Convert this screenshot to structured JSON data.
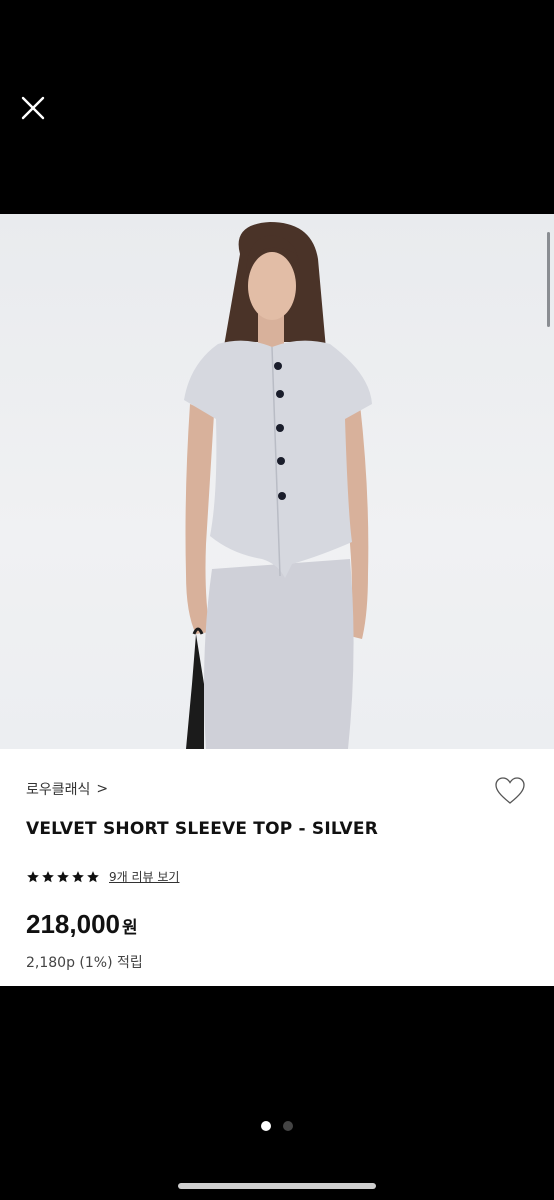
{
  "gallery": {
    "image_alt": "Model wearing velvet short sleeve top and skirt in silver",
    "current_page": 1,
    "total_pages": 2
  },
  "product": {
    "brand": "로우클래식",
    "brand_chevron": ">",
    "name": "VELVET SHORT SLEEVE TOP - SILVER",
    "rating_stars": 5,
    "review_link": "9개 리뷰 보기",
    "price": "218,000",
    "price_unit": "원",
    "points": "2,180p (1%) 적립"
  },
  "colors": {
    "background": "#000000",
    "card": "#ffffff",
    "text": "#111111"
  },
  "icons": {
    "close": "close-icon",
    "favorite": "heart-icon",
    "star": "star-icon"
  }
}
